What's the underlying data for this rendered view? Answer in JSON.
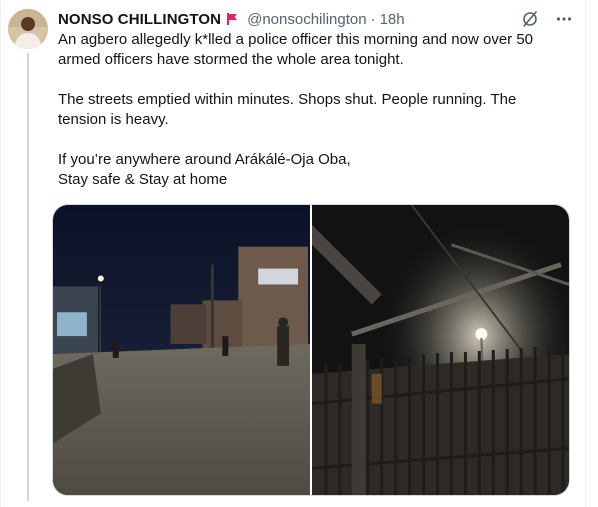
{
  "tweet": {
    "author": {
      "name": "NONSO CHILLINGTON",
      "handle": "@nonsochilington",
      "badge_icon": "red-flag-icon",
      "avatar_icon": "user-avatar-photo"
    },
    "separator": "·",
    "timestamp": "18h",
    "actions": {
      "grok_icon": "grok-icon",
      "more_icon": "more-icon"
    },
    "paragraphs": [
      "An agbero allegedly k*lled a police officer this morning and now over 50 armed officers have stormed the whole area tonight.",
      "The streets emptied within minutes. Shops shut. People running. The tension is heavy.",
      "If you’re anywhere around Arákálé-Oja Oba,\nStay safe & Stay at home"
    ],
    "media": [
      {
        "kind": "photo",
        "description_icon": "night-street-photo"
      },
      {
        "kind": "photo",
        "description_icon": "gate-streetlight-photo"
      }
    ]
  },
  "colors": {
    "text_primary": "#0f1419",
    "text_secondary": "#536471",
    "border": "#cfd9de",
    "flag_red": "#e0245e"
  }
}
